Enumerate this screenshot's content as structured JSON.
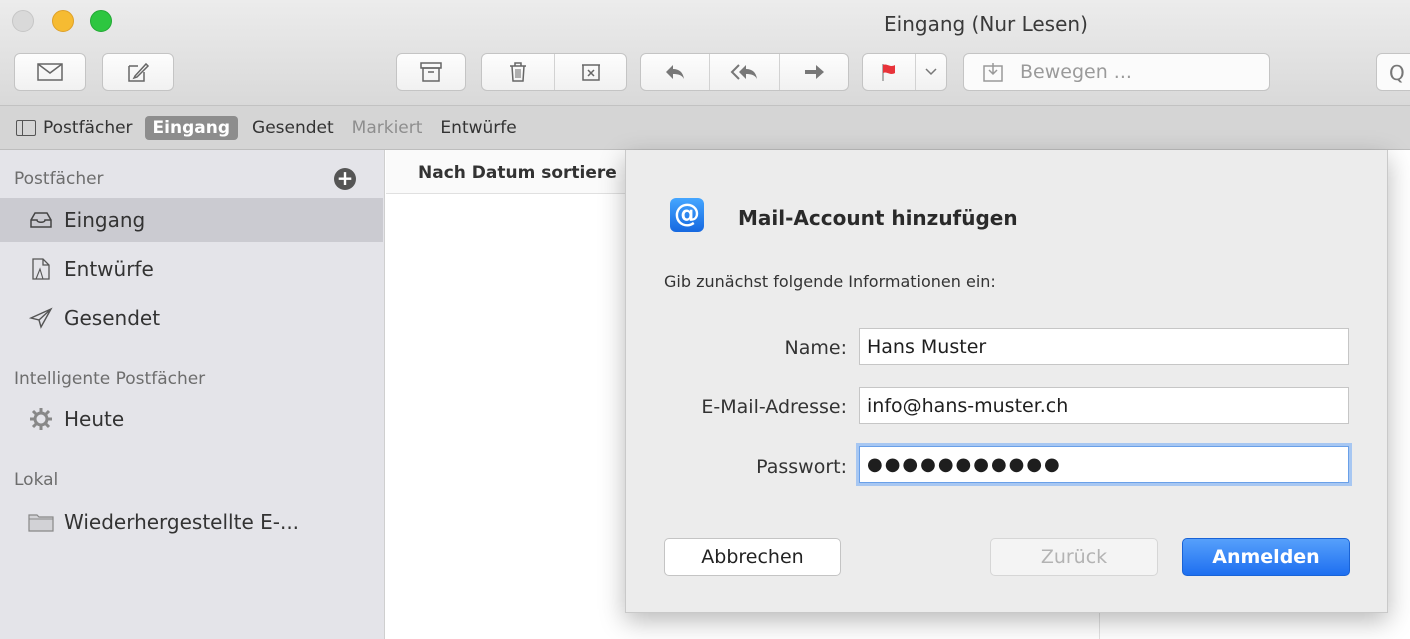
{
  "window": {
    "title": "Eingang (Nur Lesen)"
  },
  "toolbar": {
    "move_placeholder": "Bewegen ...",
    "search_glyph": "Q",
    "flag_color": "#e8333a"
  },
  "favorites": {
    "mailboxes_label": "Postfächer",
    "items": [
      "Eingang",
      "Gesendet",
      "Markiert",
      "Entwürfe"
    ]
  },
  "sidebar": {
    "section_mailboxes": "Postfächer",
    "add_glyph": "+",
    "mailboxes": [
      {
        "label": "Eingang",
        "icon": "inbox-icon"
      },
      {
        "label": "Entwürfe",
        "icon": "document-icon"
      },
      {
        "label": "Gesendet",
        "icon": "paper-plane-icon"
      }
    ],
    "section_smart": "Intelligente Postfächer",
    "smart": [
      {
        "label": "Heute",
        "icon": "gear-icon"
      }
    ],
    "section_local": "Lokal",
    "local": [
      {
        "label": "Wiederhergestellte E-...",
        "icon": "folder-icon"
      }
    ]
  },
  "list": {
    "sort_label": "Nach Datum sortiere"
  },
  "dialog": {
    "icon_glyph": "@",
    "title": "Mail-Account hinzufügen",
    "subtitle": "Gib zunächst folgende Informationen ein:",
    "fields": [
      {
        "label": "Name:",
        "value": "Hans Muster"
      },
      {
        "label": "E-Mail-Adresse:",
        "value": "info@hans-muster.ch"
      },
      {
        "label": "Passwort:",
        "value": "●●●●●●●●●●●"
      }
    ],
    "buttons": {
      "cancel": "Abbrechen",
      "back": "Zurück",
      "login": "Anmelden"
    },
    "accent_color": "#1e6ff0"
  }
}
